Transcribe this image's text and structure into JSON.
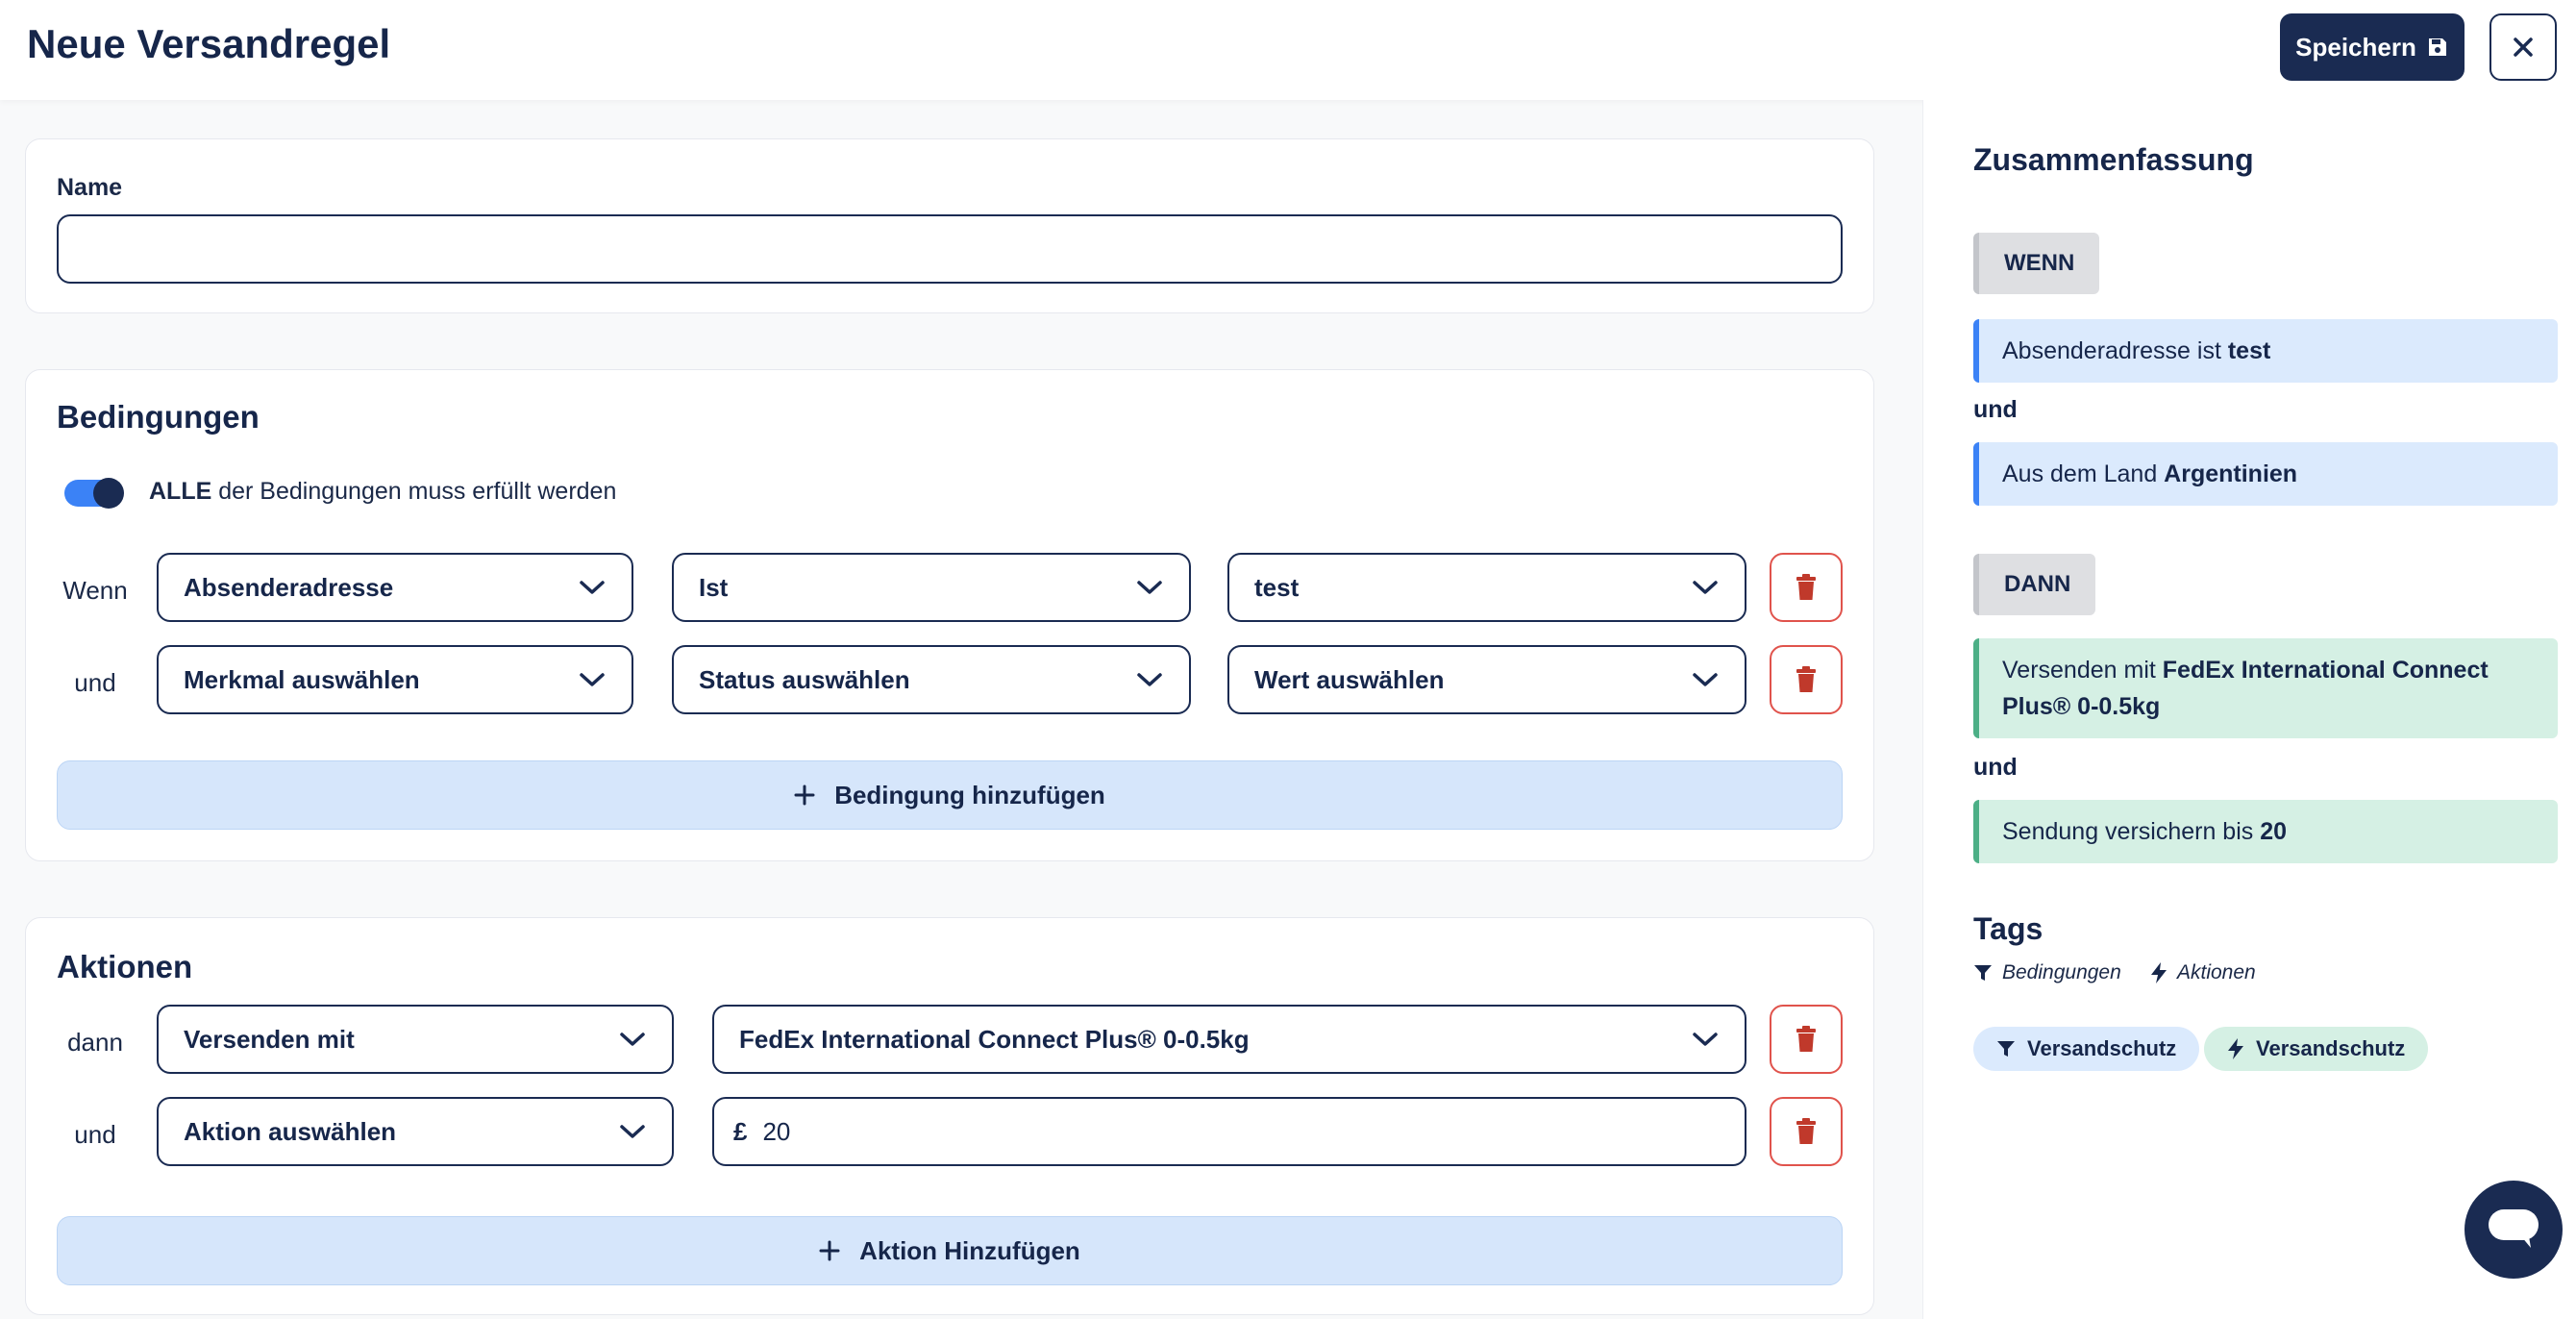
{
  "header": {
    "title": "Neue Versandregel",
    "save_label": "Speichern"
  },
  "name_card": {
    "label": "Name",
    "value": "",
    "placeholder": ""
  },
  "conditions": {
    "title": "Bedingungen",
    "toggle_on": true,
    "toggle_bold": "ALLE",
    "toggle_text": " der Bedingungen muss erfüllt werden",
    "rows": [
      {
        "prefix": "Wenn",
        "field": "Absenderadresse",
        "operator": "Ist",
        "value": "test"
      },
      {
        "prefix": "und",
        "field": "Merkmal auswählen",
        "operator": "Status auswählen",
        "value": "Wert auswählen"
      }
    ],
    "add_label": "Bedingung hinzufügen"
  },
  "actions": {
    "title": "Aktionen",
    "rows": [
      {
        "prefix": "dann",
        "action": "Versenden mit",
        "value": "FedEx International Connect Plus® 0-0.5kg"
      },
      {
        "prefix": "und",
        "action": "Aktion auswählen",
        "currency": "£",
        "amount": "20"
      }
    ],
    "add_label": "Aktion Hinzufügen"
  },
  "summary": {
    "title": "Zusammenfassung",
    "if_label": "WENN",
    "conditions": [
      {
        "text": "Absenderadresse ist ",
        "bold": "test"
      },
      {
        "text": "Aus dem Land ",
        "bold": "Argentinien"
      }
    ],
    "and_label": "und",
    "then_label": "DANN",
    "actions": [
      {
        "text": "Versenden mit ",
        "bold": "FedEx International Connect Plus® 0-0.5kg"
      },
      {
        "text": "Sendung versichern bis ",
        "bold": "20"
      }
    ]
  },
  "tags": {
    "title": "Tags",
    "legend_conditions": "Bedingungen",
    "legend_actions": "Aktionen",
    "items": [
      {
        "type": "condition",
        "label": "Versandschutz"
      },
      {
        "type": "action",
        "label": "Versandschutz"
      }
    ]
  },
  "colors": {
    "primary": "#1a2b52",
    "accent": "#3b82f6",
    "danger": "#c0392b",
    "condition_bg": "#dbeafd",
    "action_bg": "#d5f0e4"
  }
}
